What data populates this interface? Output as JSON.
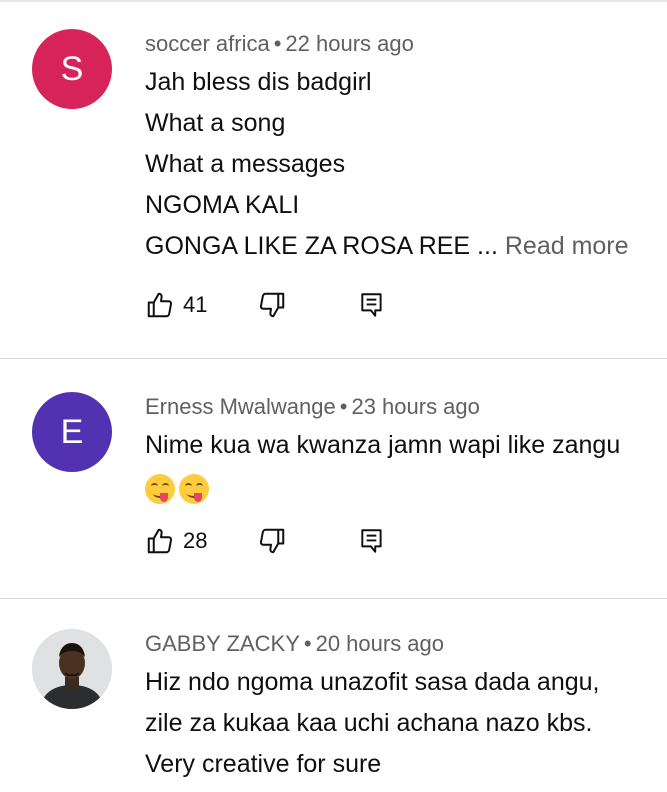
{
  "comments": [
    {
      "avatar_letter": "S",
      "avatar_color": "#d6245a",
      "author": "soccer africa",
      "separator": "•",
      "time": "22 hours ago",
      "lines": [
        "Jah bless dis badgirl",
        "What a song",
        "What a messages",
        "NGOMA KALI",
        "GONGA LIKE ZA ROSA REE ..."
      ],
      "read_more": "Read more",
      "likes": "41"
    },
    {
      "avatar_letter": "E",
      "avatar_color": "#5232b0",
      "author": "Erness Mwalwange",
      "separator": "•",
      "time": "23 hours ago",
      "lines": [
        "Nime kua wa kwanza jamn wapi like zangu"
      ],
      "emojis": [
        "savoring-food-emoji",
        "savoring-food-emoji"
      ],
      "likes": "28"
    },
    {
      "avatar_type": "photo",
      "author": "GABBY ZACKY",
      "separator": "•",
      "time": "20 hours ago",
      "lines": [
        "Hiz ndo ngoma unazofit sasa dada angu,",
        "zile za kukaa kaa uchi achana nazo kbs.",
        "Very creative for sure"
      ]
    }
  ],
  "icons": {
    "like": "thumb-up-outline-icon",
    "dislike": "thumb-down-outline-icon",
    "reply": "reply-comment-icon"
  },
  "colors": {
    "text_primary": "#0f0f0f",
    "text_secondary": "#606060",
    "divider": "#d9d9d9"
  }
}
